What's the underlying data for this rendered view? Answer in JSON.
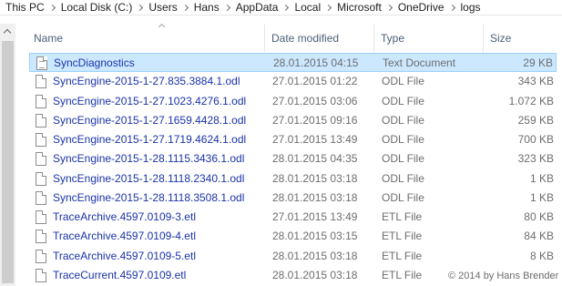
{
  "breadcrumb": [
    "This PC",
    "Local Disk (C:)",
    "Users",
    "Hans",
    "AppData",
    "Local",
    "Microsoft",
    "OneDrive",
    "logs"
  ],
  "columns": {
    "name": "Name",
    "date_modified": "Date modified",
    "type": "Type",
    "size": "Size"
  },
  "files": [
    {
      "name": "SyncDiagnostics",
      "date": "28.01.2015 04:15",
      "type": "Text Document",
      "size": "29 KB",
      "selected": true,
      "icon": "text-document-icon"
    },
    {
      "name": "SyncEngine-2015-1-27.835.3884.1.odl",
      "date": "27.01.2015 01:22",
      "type": "ODL File",
      "size": "343 KB",
      "icon": "file-icon"
    },
    {
      "name": "SyncEngine-2015-1-27.1023.4276.1.odl",
      "date": "27.01.2015 03:06",
      "type": "ODL File",
      "size": "1.072 KB",
      "icon": "file-icon"
    },
    {
      "name": "SyncEngine-2015-1-27.1659.4428.1.odl",
      "date": "27.01.2015 09:16",
      "type": "ODL File",
      "size": "259 KB",
      "icon": "file-icon"
    },
    {
      "name": "SyncEngine-2015-1-27.1719.4624.1.odl",
      "date": "27.01.2015 13:49",
      "type": "ODL File",
      "size": "700 KB",
      "icon": "file-icon"
    },
    {
      "name": "SyncEngine-2015-1-28.1115.3436.1.odl",
      "date": "28.01.2015 04:35",
      "type": "ODL File",
      "size": "323 KB",
      "icon": "file-icon"
    },
    {
      "name": "SyncEngine-2015-1-28.1118.2340.1.odl",
      "date": "28.01.2015 03:18",
      "type": "ODL File",
      "size": "1 KB",
      "icon": "file-icon"
    },
    {
      "name": "SyncEngine-2015-1-28.1118.3508.1.odl",
      "date": "28.01.2015 03:18",
      "type": "ODL File",
      "size": "1 KB",
      "icon": "file-icon"
    },
    {
      "name": "TraceArchive.4597.0109-3.etl",
      "date": "27.01.2015 13:49",
      "type": "ETL File",
      "size": "80 KB",
      "icon": "file-icon"
    },
    {
      "name": "TraceArchive.4597.0109-4.etl",
      "date": "28.01.2015 03:15",
      "type": "ETL File",
      "size": "84 KB",
      "icon": "file-icon"
    },
    {
      "name": "TraceArchive.4597.0109-5.etl",
      "date": "28.01.2015 03:18",
      "type": "ETL File",
      "size": "8 KB",
      "icon": "file-icon"
    },
    {
      "name": "TraceCurrent.4597.0109.etl",
      "date": "28.01.2015 03:18",
      "type": "ETL File",
      "size": "8 KB",
      "icon": "file-icon"
    }
  ],
  "watermark": "© 2014 by Hans Brender"
}
